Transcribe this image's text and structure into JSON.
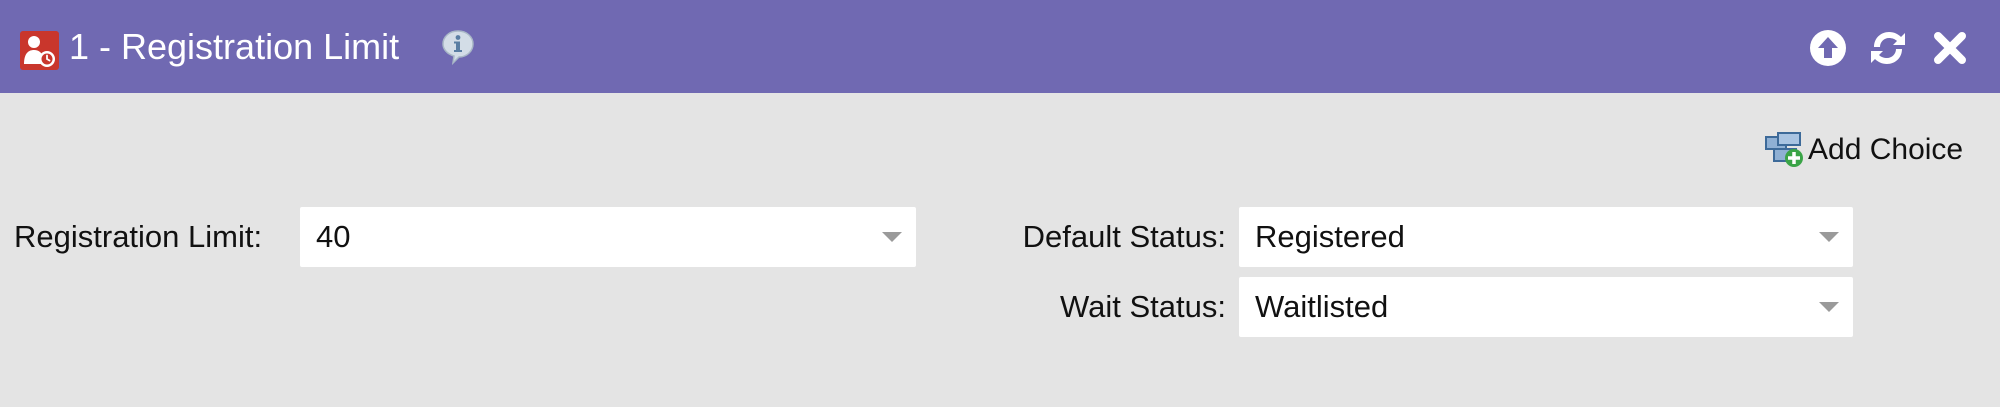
{
  "header": {
    "title": "1 - Registration Limit",
    "background_color": "#7069b2",
    "step_icon": "registration-limit-step-icon",
    "info_icon": "info-icon",
    "buttons": [
      {
        "icon": "arrow-up-circle-icon",
        "action": "move-up"
      },
      {
        "icon": "refresh-icon",
        "action": "refresh"
      },
      {
        "icon": "close-icon",
        "action": "close"
      }
    ]
  },
  "toolbar": {
    "add_choice_label": "Add Choice",
    "add_choice_icon": "add-choice-icon"
  },
  "form": {
    "registration_limit": {
      "label": "Registration Limit:",
      "value": "40"
    },
    "default_status": {
      "label": "Default Status:",
      "value": "Registered"
    },
    "wait_status": {
      "label": "Wait Status:",
      "value": "Waitlisted"
    }
  },
  "colors": {
    "panel_background": "#e4e4e4",
    "header": "#7069b2",
    "step_icon_red": "#c9362c",
    "dropdown_arrow": "#9a9a9a"
  }
}
